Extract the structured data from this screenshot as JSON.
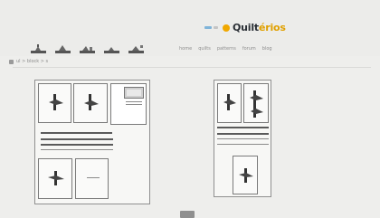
{
  "logo": {
    "text_a": "Quilt",
    "text_b": "érios"
  },
  "toolbar": {
    "icons": [
      "block-icon",
      "block-icon",
      "block-icon",
      "block-icon",
      "block-icon"
    ]
  },
  "nav": {
    "items": [
      "home",
      "quilts",
      "patterns",
      "forum",
      "blog"
    ]
  },
  "path": {
    "label": "ul > block > s"
  },
  "colors": {
    "accent": "#f0a800",
    "logo_dark": "#2a2f35",
    "logo_blue": "#7fb4d9",
    "sheet_border": "#8f8f8f"
  }
}
